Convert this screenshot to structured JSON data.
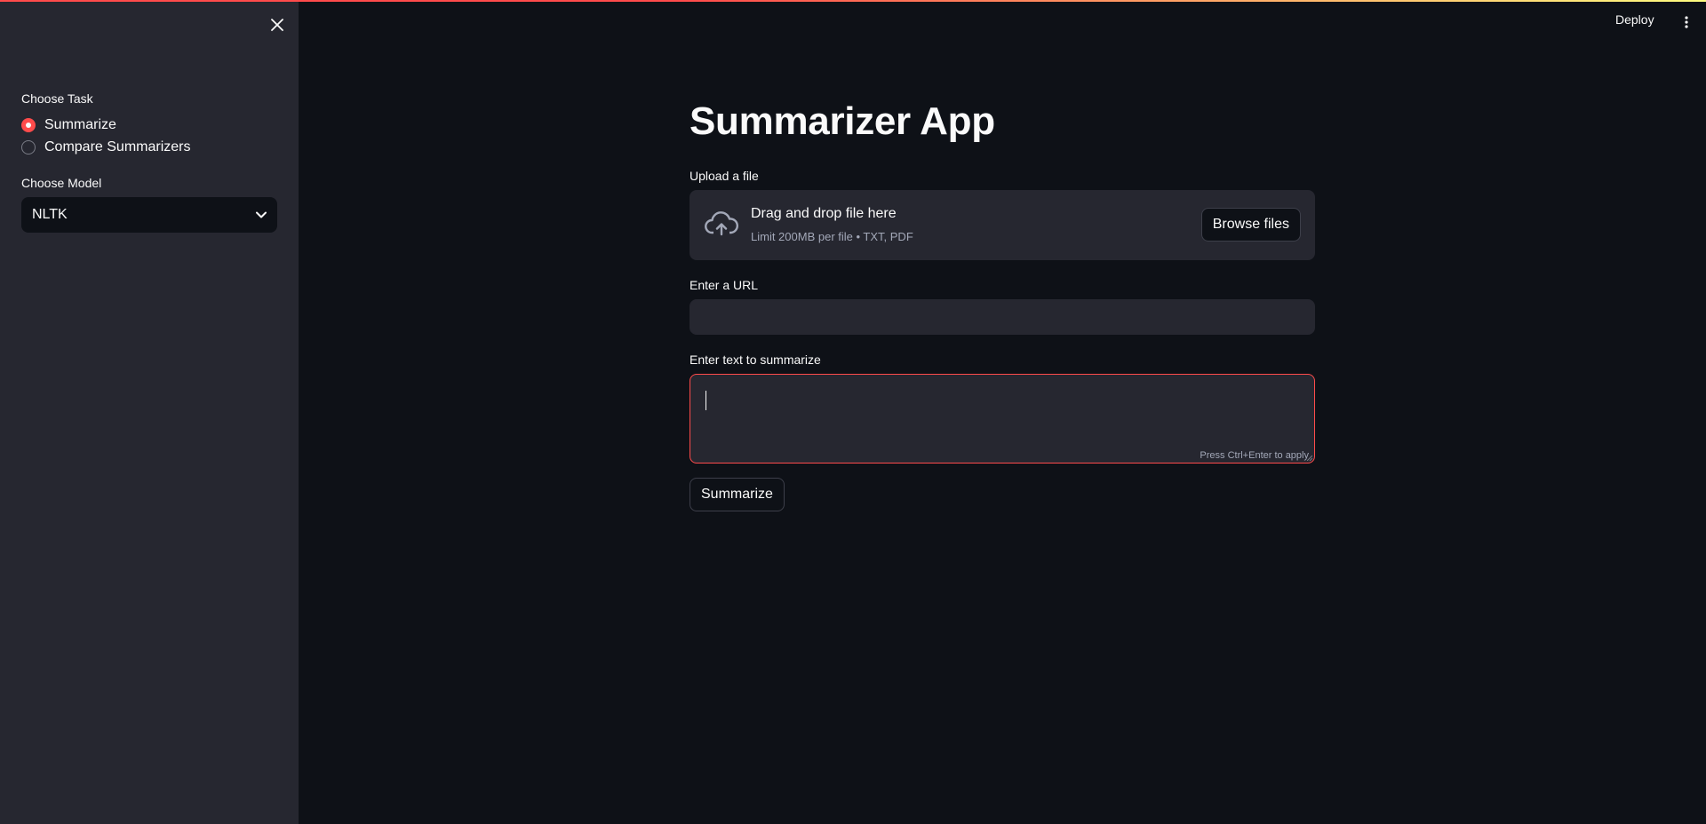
{
  "colors": {
    "accent": "#ff4b4b",
    "background": "#0e1117",
    "sidebar": "#262730",
    "text": "#fafafa",
    "muted": "#a3a8b8"
  },
  "sidebar": {
    "close_icon": "close-icon",
    "task_label": "Choose Task",
    "task_options": [
      {
        "label": "Summarize",
        "selected": true
      },
      {
        "label": "Compare Summarizers",
        "selected": false
      }
    ],
    "model_label": "Choose Model",
    "model_value": "NLTK",
    "model_icon": "chevron-down-icon"
  },
  "header": {
    "deploy_label": "Deploy",
    "menu_icon": "vertical-dots-icon"
  },
  "main": {
    "title": "Summarizer App",
    "upload": {
      "label": "Upload a file",
      "icon": "cloud-upload-icon",
      "title": "Drag and drop file here",
      "limit": "Limit 200MB per file • TXT, PDF",
      "browse_label": "Browse files"
    },
    "url": {
      "label": "Enter a URL",
      "value": "",
      "placeholder": ""
    },
    "text": {
      "label": "Enter text to summarize",
      "value": "",
      "hint": "Press Ctrl+Enter to apply"
    },
    "submit_label": "Summarize"
  }
}
